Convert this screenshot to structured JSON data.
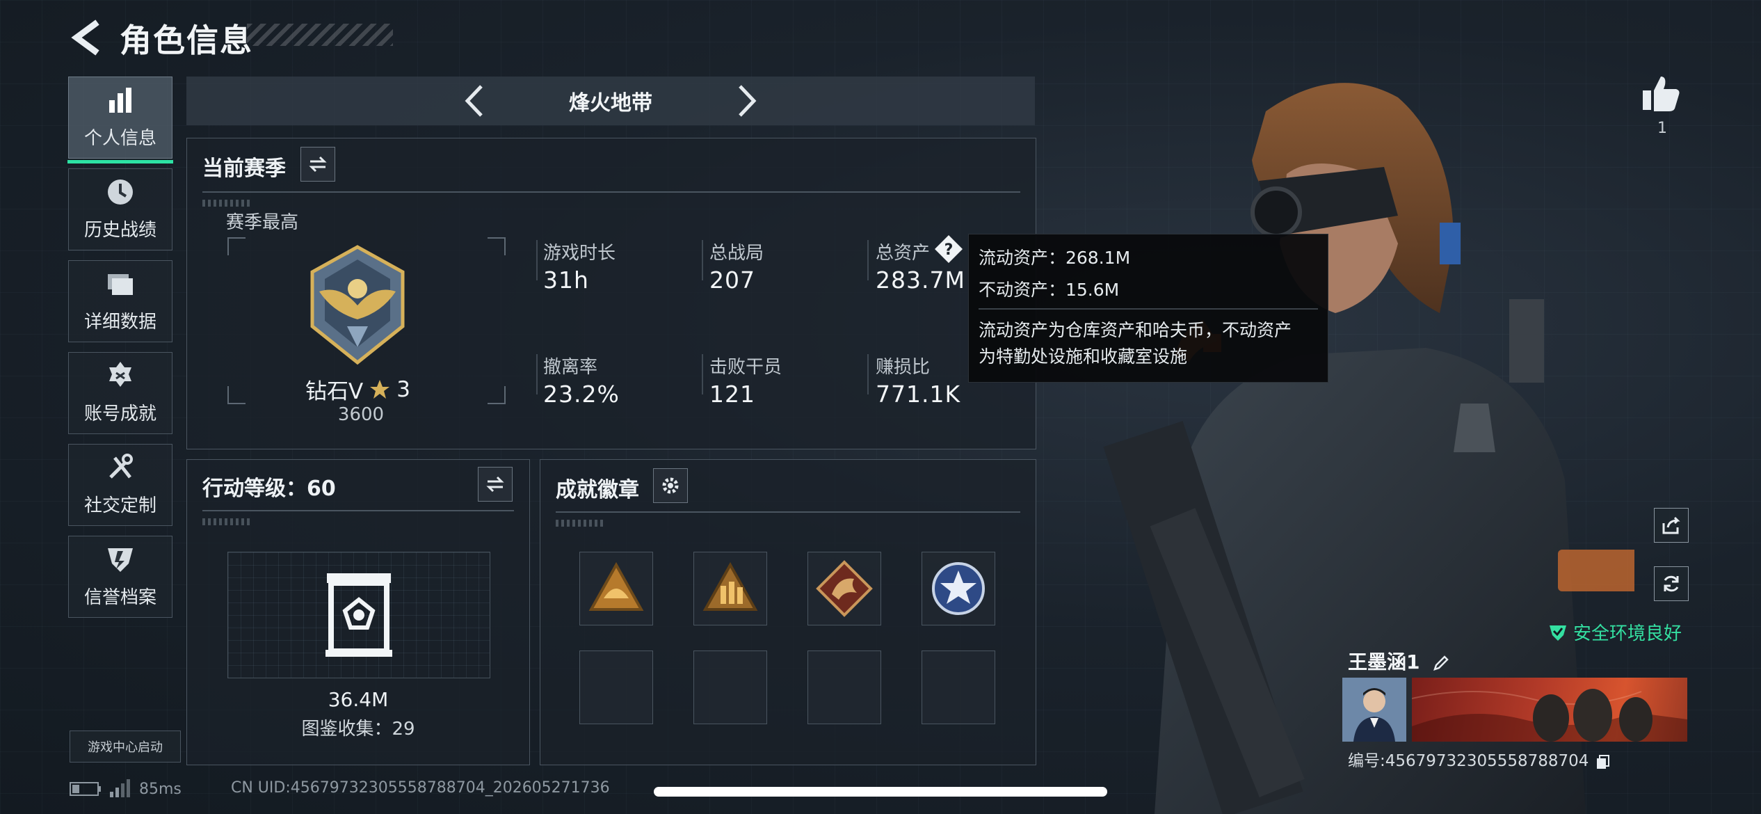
{
  "header": {
    "title": "角色信息"
  },
  "nav": {
    "items": [
      {
        "label": "个人信息",
        "icon": "bar-chart-icon"
      },
      {
        "label": "历史战绩",
        "icon": "clock-icon"
      },
      {
        "label": "详细数据",
        "icon": "folder-icon"
      },
      {
        "label": "账号成就",
        "icon": "medal-icon"
      },
      {
        "label": "社交定制",
        "icon": "tools-icon"
      },
      {
        "label": "信誉档案",
        "icon": "shield-icon"
      }
    ],
    "active_index": 0,
    "game_center": "游戏中心启动"
  },
  "mode": {
    "name": "烽火地带"
  },
  "season": {
    "title": "当前赛季",
    "best_label": "赛季最高",
    "rank": "钻石V",
    "stars": "3",
    "score": "3600",
    "stats": [
      {
        "label": "游戏时长",
        "value": "31h"
      },
      {
        "label": "总战局",
        "value": "207"
      },
      {
        "label": "总资产",
        "value": "283.7M"
      },
      {
        "label": "撤离率",
        "value": "23.2%"
      },
      {
        "label": "击败干员",
        "value": "121"
      },
      {
        "label": "赚损比",
        "value": "771.1K"
      }
    ]
  },
  "tooltip": {
    "liquid": "流动资产：268.1M",
    "fixed": "不动资产：15.6M",
    "desc_line1": "流动资产为仓库资产和哈夫币，不动资产",
    "desc_line2": "为特勤处设施和收藏室设施"
  },
  "action_level": {
    "title": "行动等级：60",
    "value": "36.4M",
    "collection": "图鉴收集：29"
  },
  "achievements": {
    "title": "成就徽章",
    "badges": [
      "helmet-badge-icon",
      "soldiers-badge-icon",
      "dragon-badge-icon",
      "star-badge-icon"
    ]
  },
  "right": {
    "like_count": "1",
    "safe_text": "安全环境良好",
    "player_name": "王墨涵1",
    "player_id": "编号:456797323055587887​04"
  },
  "status": {
    "ping": "85ms",
    "uid": "CN UID:4567973230555878870​4_202605271736"
  },
  "colors": {
    "accent": "#2de2a4",
    "panel_border": "#4a5560",
    "rank_gold": "#d6b15a"
  }
}
